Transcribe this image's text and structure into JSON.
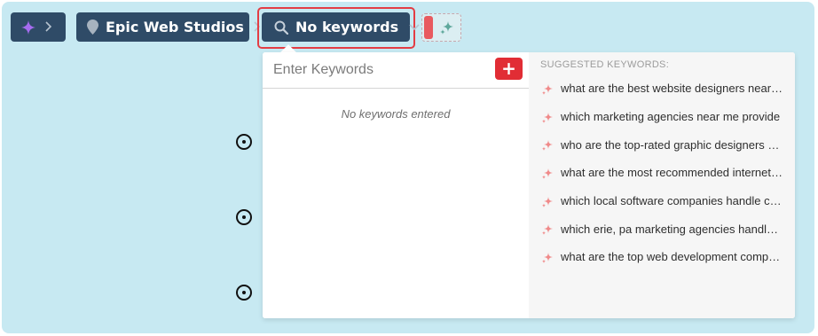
{
  "breadcrumb": {
    "ai_item": {
      "icon": "sparkle-icon",
      "chevron": ">"
    },
    "location": {
      "label": "Epic Web Studios",
      "icon": "map-pin-icon",
      "chevron": ">"
    },
    "keywords": {
      "label": "No keywords",
      "icon": "search-icon",
      "chevron": "chevron-down-icon"
    }
  },
  "keyword_panel": {
    "input_placeholder": "Enter Keywords",
    "add_button_label": "+",
    "empty_message": "No keywords entered",
    "suggested_heading": "SUGGESTED KEYWORDS:",
    "suggestions": [
      "what are the best website designers near me",
      "which marketing agencies near me provide",
      "who are the top-rated graphic designers near me",
      "what are the most recommended internet marketing firms",
      "which local software companies handle custom apps",
      "which erie, pa marketing agencies handle branding",
      "what are the top web development companies"
    ]
  },
  "colors": {
    "background": "#c7e9f2",
    "breadcrumb": "#2f4b67",
    "accent_red": "#e12d35",
    "ai_purple": "#a66cf0"
  }
}
